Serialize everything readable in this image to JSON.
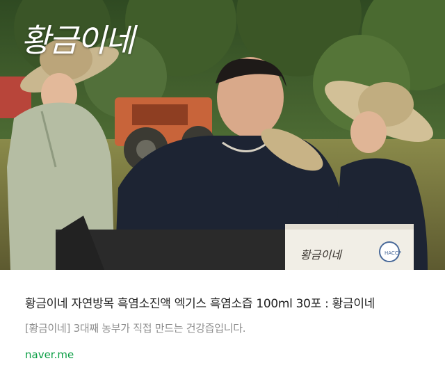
{
  "link_card": {
    "thumbnail": {
      "brand_logo_text": "황금이네",
      "packet_label": "황금이네",
      "alt": "황금이네 자연방목 흑염소진액"
    },
    "title": "황금이네 자연방목 흑염소진액 엑기스 흑염소즙 100ml 30포 : 황금이네",
    "description": "[황금이네] 3대째 농부가 직접 만드는 건강즙입니다.",
    "domain": "naver.me"
  },
  "colors": {
    "title": "#1f1f1f",
    "description": "#8e8e8e",
    "domain": "#0a9e44",
    "background": "#ffffff"
  }
}
